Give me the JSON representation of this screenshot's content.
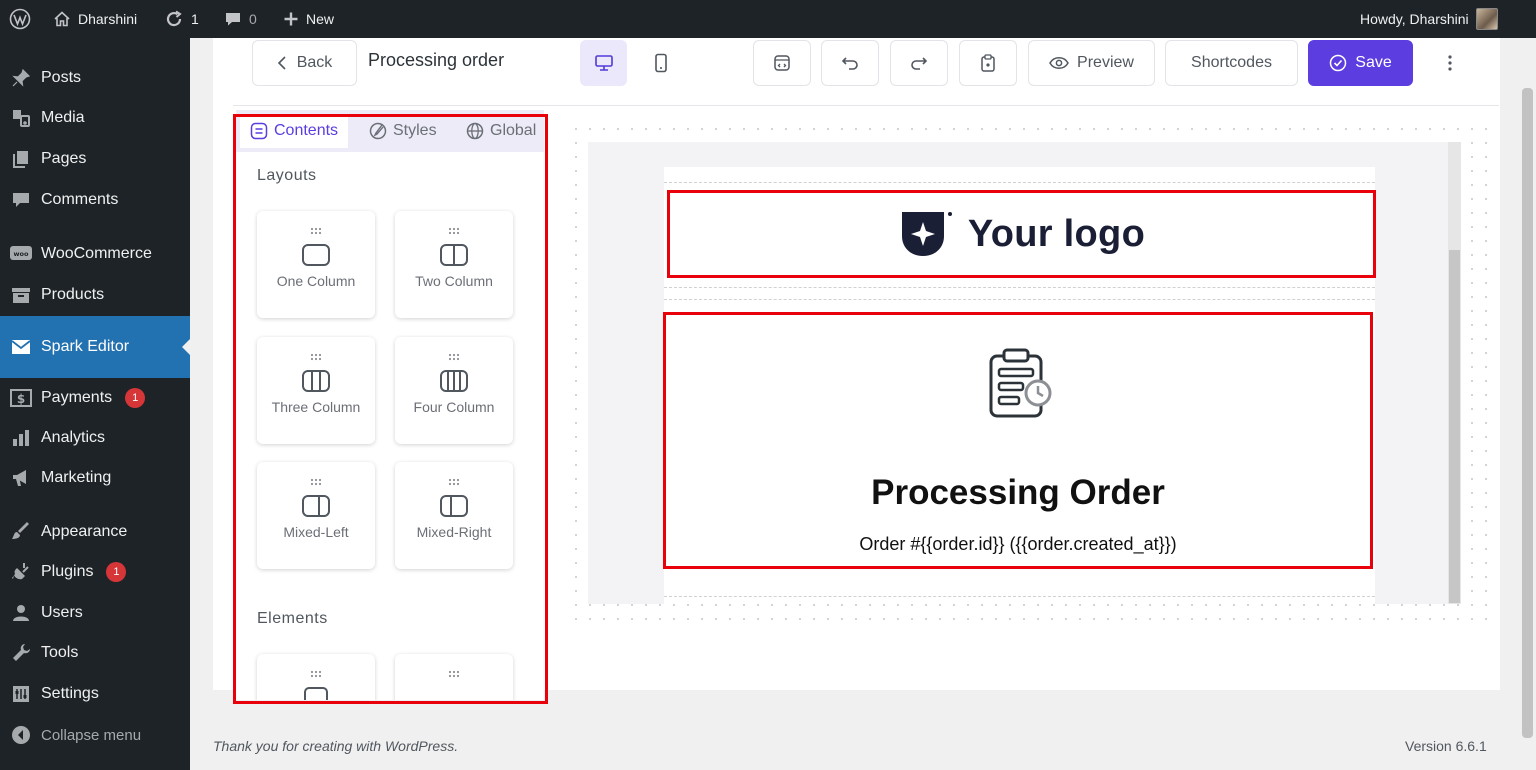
{
  "admin_bar": {
    "site_name": "Dharshini",
    "updates_count": "1",
    "comments_count": "0",
    "new_label": "New",
    "howdy": "Howdy, Dharshini"
  },
  "sidebar": {
    "items": [
      {
        "label": "Posts",
        "icon": "pin-icon"
      },
      {
        "label": "Media",
        "icon": "media-icon"
      },
      {
        "label": "Pages",
        "icon": "pages-icon"
      },
      {
        "label": "Comments",
        "icon": "comment-icon"
      },
      {
        "label": "WooCommerce",
        "icon": "woo-icon"
      },
      {
        "label": "Products",
        "icon": "products-icon"
      },
      {
        "label": "Spark Editor",
        "icon": "envelope-icon",
        "active": true
      },
      {
        "label": "Payments",
        "icon": "payments-icon",
        "badge": "1"
      },
      {
        "label": "Analytics",
        "icon": "analytics-icon"
      },
      {
        "label": "Marketing",
        "icon": "megaphone-icon"
      },
      {
        "label": "Appearance",
        "icon": "brush-icon"
      },
      {
        "label": "Plugins",
        "icon": "plug-icon",
        "badge": "1"
      },
      {
        "label": "Users",
        "icon": "user-icon"
      },
      {
        "label": "Tools",
        "icon": "wrench-icon"
      },
      {
        "label": "Settings",
        "icon": "settings-icon"
      },
      {
        "label": "Collapse menu",
        "icon": "collapse-icon"
      }
    ]
  },
  "toolbar": {
    "back_label": "Back",
    "title": "Processing order",
    "preview_label": "Preview",
    "shortcodes_label": "Shortcodes",
    "save_label": "Save"
  },
  "panel": {
    "tabs": [
      {
        "label": "Contents",
        "active": true
      },
      {
        "label": "Styles"
      },
      {
        "label": "Global"
      }
    ],
    "layouts_title": "Layouts",
    "layouts": [
      "One Column",
      "Two Column",
      "Three Column",
      "Four Column",
      "Mixed-Left",
      "Mixed-Right"
    ],
    "elements_title": "Elements"
  },
  "email": {
    "logo_text": "Your logo",
    "heading": "Processing Order",
    "subtext": "Order #{{order.id}} ({{order.created_at}})"
  },
  "footer": {
    "thanks": "Thank you for creating with WordPress.",
    "version": "Version 6.6.1"
  },
  "colors": {
    "accent": "#5b3de0",
    "wp_blue": "#2271b1",
    "highlight_red": "#e8000b"
  }
}
